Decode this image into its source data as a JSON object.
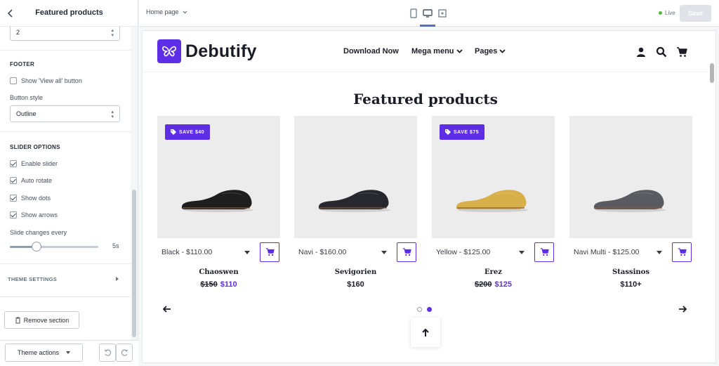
{
  "sidebar": {
    "title": "Featured products",
    "columns_value": "2",
    "footer": {
      "heading": "FOOTER",
      "show_view_all": {
        "label": "Show 'View all' button",
        "checked": false
      },
      "button_style_label": "Button style",
      "button_style_value": "Outline"
    },
    "slider": {
      "heading": "SLIDER OPTIONS",
      "options": [
        {
          "label": "Enable slider",
          "checked": true
        },
        {
          "label": "Auto rotate",
          "checked": true
        },
        {
          "label": "Show dots",
          "checked": true
        },
        {
          "label": "Show arrows",
          "checked": true
        }
      ],
      "slide_changes_label": "Slide changes every",
      "slide_changes_value": "5s",
      "slide_changes_fraction": 0.3
    },
    "theme_settings": "THEME SETTINGS",
    "remove_section": "Remove section",
    "theme_actions": "Theme actions"
  },
  "topbar": {
    "page_selector": "Home page",
    "live": "Live",
    "save": "Save"
  },
  "store": {
    "logo": "Debutify",
    "nav": [
      "Download Now",
      "Mega menu",
      "Pages"
    ],
    "section_title": "Featured products",
    "products": [
      {
        "badge": "SAVE $40",
        "variant": "Black - $110.00",
        "name": "Chaoswen",
        "old_price": "$150",
        "price": "$110",
        "color": "#1e1e1f"
      },
      {
        "badge": "",
        "variant": "Navi - $160.00",
        "name": "Sevigorien",
        "old_price": "",
        "price": "$160",
        "color": "#26282d"
      },
      {
        "badge": "SAVE $75",
        "variant": "Yellow - $125.00",
        "name": "Erez",
        "old_price": "$200",
        "price": "$125",
        "color": "#d8b04a"
      },
      {
        "badge": "",
        "variant": "Navi Multi - $125.00",
        "name": "Stassinos",
        "old_price": "",
        "price": "$110+",
        "color": "#5a5b60"
      }
    ]
  },
  "colors": {
    "brand": "#5d2ee6",
    "live": "#50b83c",
    "save_disabled": "#dfe3e8"
  }
}
